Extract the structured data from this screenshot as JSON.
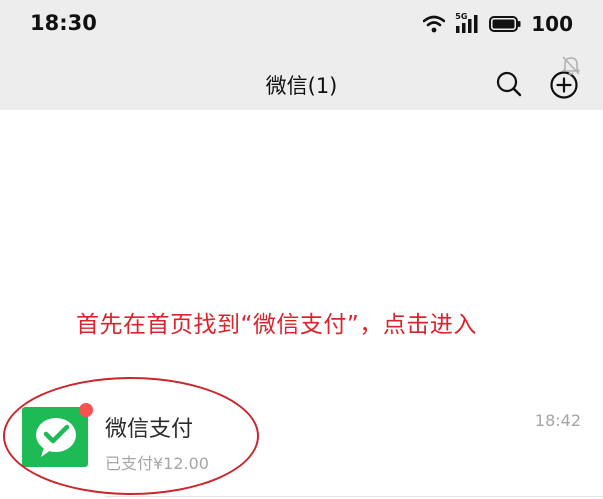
{
  "status_bar": {
    "time": "18:30",
    "network": "5G",
    "battery": "100"
  },
  "nav": {
    "title": "微信(1)",
    "search_icon": "search-icon",
    "add_icon": "plus-circle-icon"
  },
  "annotation": {
    "text": "首先在首页找到“微信支付”，点击进入"
  },
  "chat_list": [
    {
      "name": "微信支付",
      "preview": "已支付¥12.00",
      "time": "18:42",
      "icon": "wechat-pay-icon",
      "muted": true,
      "unread_dot": true
    }
  ],
  "colors": {
    "header_bg": "#ededed",
    "annotation": "#d8242c",
    "wechat_green": "#1eba55",
    "badge": "#fa5151"
  }
}
